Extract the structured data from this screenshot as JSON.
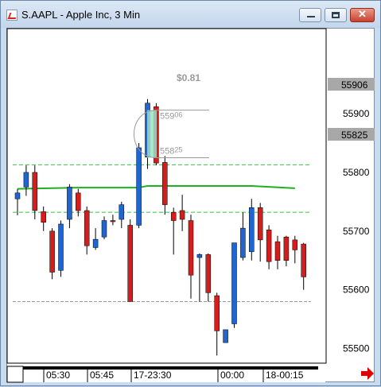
{
  "window": {
    "title": "S.AAPL - Apple Inc, 3 Min",
    "minimize_icon": "minimize-icon",
    "maximize_icon": "maximize-icon",
    "close_icon": "close-icon"
  },
  "chart_data": {
    "type": "candlestick",
    "ylim": [
      55475,
      56045
    ],
    "y_ticks": [
      "55900",
      "55800",
      "55700",
      "55600",
      "55500"
    ],
    "x_labels": [
      "05:30",
      "05:45",
      "17-23:30",
      "00:00",
      "18-00:15"
    ],
    "price_marker_top": "55906",
    "price_marker_bottom": "55825",
    "colors": {
      "up": "#1f66d1",
      "down": "#d41e1e",
      "ma": "#20b020",
      "level": "#3fb74f",
      "ref": "#9a9a9a",
      "marker_bg": "#a8a8a8"
    },
    "measure": {
      "label": "$0.81",
      "top_value": "559",
      "top_sup": "06",
      "bottom_value": "558",
      "bottom_sup": "25",
      "top_price": 55906,
      "bottom_price": 55825
    },
    "level_lines": [
      55813,
      55732
    ],
    "ref_line": 55580,
    "moving_average": [
      [
        0,
        55772
      ],
      [
        7,
        55774
      ],
      [
        14,
        55774
      ],
      [
        15,
        55777
      ],
      [
        27,
        55777
      ],
      [
        32,
        55773
      ]
    ],
    "candles": [
      {
        "o": 55755,
        "h": 55772,
        "l": 55727,
        "c": 55765
      },
      {
        "o": 55775,
        "h": 55812,
        "l": 55760,
        "c": 55800
      },
      {
        "o": 55800,
        "h": 55812,
        "l": 55720,
        "c": 55735
      },
      {
        "o": 55733,
        "h": 55742,
        "l": 55700,
        "c": 55715
      },
      {
        "o": 55700,
        "h": 55705,
        "l": 55618,
        "c": 55630
      },
      {
        "o": 55633,
        "h": 55718,
        "l": 55622,
        "c": 55712
      },
      {
        "o": 55720,
        "h": 55780,
        "l": 55705,
        "c": 55775
      },
      {
        "o": 55765,
        "h": 55772,
        "l": 55725,
        "c": 55735
      },
      {
        "o": 55735,
        "h": 55742,
        "l": 55660,
        "c": 55675
      },
      {
        "o": 55672,
        "h": 55705,
        "l": 55668,
        "c": 55686
      },
      {
        "o": 55690,
        "h": 55725,
        "l": 55686,
        "c": 55718
      },
      {
        "o": 55718,
        "h": 55728,
        "l": 55710,
        "c": 55716
      },
      {
        "o": 55720,
        "h": 55750,
        "l": 55705,
        "c": 55745
      },
      {
        "o": 55710,
        "h": 55720,
        "l": 55580,
        "c": 55580
      },
      {
        "o": 55710,
        "h": 55850,
        "l": 55705,
        "c": 55842
      },
      {
        "o": 55826,
        "h": 55925,
        "l": 55806,
        "c": 55918
      },
      {
        "o": 55912,
        "h": 55918,
        "l": 55812,
        "c": 55816
      },
      {
        "o": 55817,
        "h": 55828,
        "l": 55728,
        "c": 55745
      },
      {
        "o": 55732,
        "h": 55740,
        "l": 55660,
        "c": 55718
      },
      {
        "o": 55735,
        "h": 55762,
        "l": 55700,
        "c": 55720
      },
      {
        "o": 55718,
        "h": 55728,
        "l": 55585,
        "c": 55625
      },
      {
        "o": 55655,
        "h": 55662,
        "l": 55580,
        "c": 55660
      },
      {
        "o": 55660,
        "h": 55662,
        "l": 55580,
        "c": 55595
      },
      {
        "o": 55590,
        "h": 55595,
        "l": 55488,
        "c": 55530
      },
      {
        "o": 55510,
        "h": 55532,
        "l": 55510,
        "c": 55532
      },
      {
        "o": 55542,
        "h": 55680,
        "l": 55535,
        "c": 55680
      },
      {
        "o": 55655,
        "h": 55732,
        "l": 55650,
        "c": 55705
      },
      {
        "o": 55665,
        "h": 55755,
        "l": 55650,
        "c": 55740
      },
      {
        "o": 55740,
        "h": 55748,
        "l": 55648,
        "c": 55685
      },
      {
        "o": 55702,
        "h": 55710,
        "l": 55635,
        "c": 55648
      },
      {
        "o": 55682,
        "h": 55692,
        "l": 55635,
        "c": 55650
      },
      {
        "o": 55690,
        "h": 55692,
        "l": 55640,
        "c": 55650
      },
      {
        "o": 55685,
        "h": 55692,
        "l": 55645,
        "c": 55668
      },
      {
        "o": 55678,
        "h": 55680,
        "l": 55600,
        "c": 55622
      }
    ]
  }
}
